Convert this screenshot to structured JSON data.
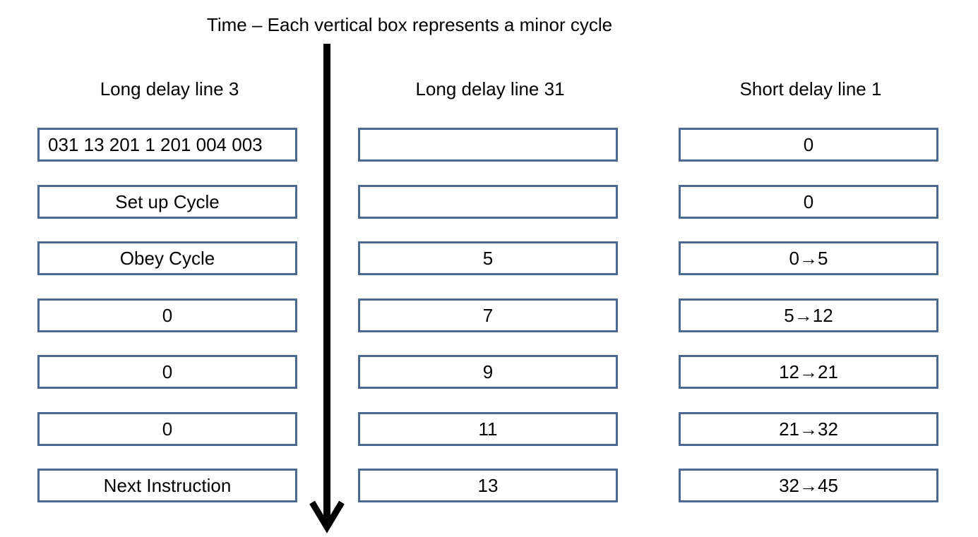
{
  "title": "Time – Each vertical box represents a minor cycle",
  "columns": [
    {
      "header": "Long delay line 3",
      "cells": [
        "031 13 201 1 201 004 003",
        "Set up Cycle",
        "Obey Cycle",
        "0",
        "0",
        "0",
        "Next Instruction"
      ]
    },
    {
      "header": "Long delay line 31",
      "cells": [
        "",
        "",
        "5",
        "7",
        "9",
        "11",
        "13"
      ]
    },
    {
      "header": "Short delay line 1",
      "cells": [
        "0",
        "0",
        "0→5",
        "5→12",
        "12→21",
        "21→32",
        "32→45"
      ]
    }
  ],
  "colors": {
    "box_border": "#4a6890",
    "arrow": "#000000"
  }
}
